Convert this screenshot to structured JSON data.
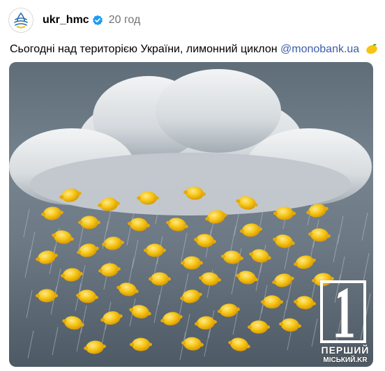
{
  "post": {
    "username": "ukr_hmc",
    "time": "20 год",
    "caption_text": "Сьогодні над територією України, лимонний циклон",
    "caption_mention": "@monobank.ua",
    "caption_emoji": "lemon-emoji",
    "verified_icon": "verified-badge-icon"
  },
  "watermark": {
    "numeral": "1",
    "line1": "ПЕРШИЙ",
    "line2": "МІСЬКИЙ.KR"
  },
  "colors": {
    "verified": "#1d9bf0",
    "mention": "#3b5ea8",
    "lemon": "#f6c514",
    "time": "#737373"
  }
}
